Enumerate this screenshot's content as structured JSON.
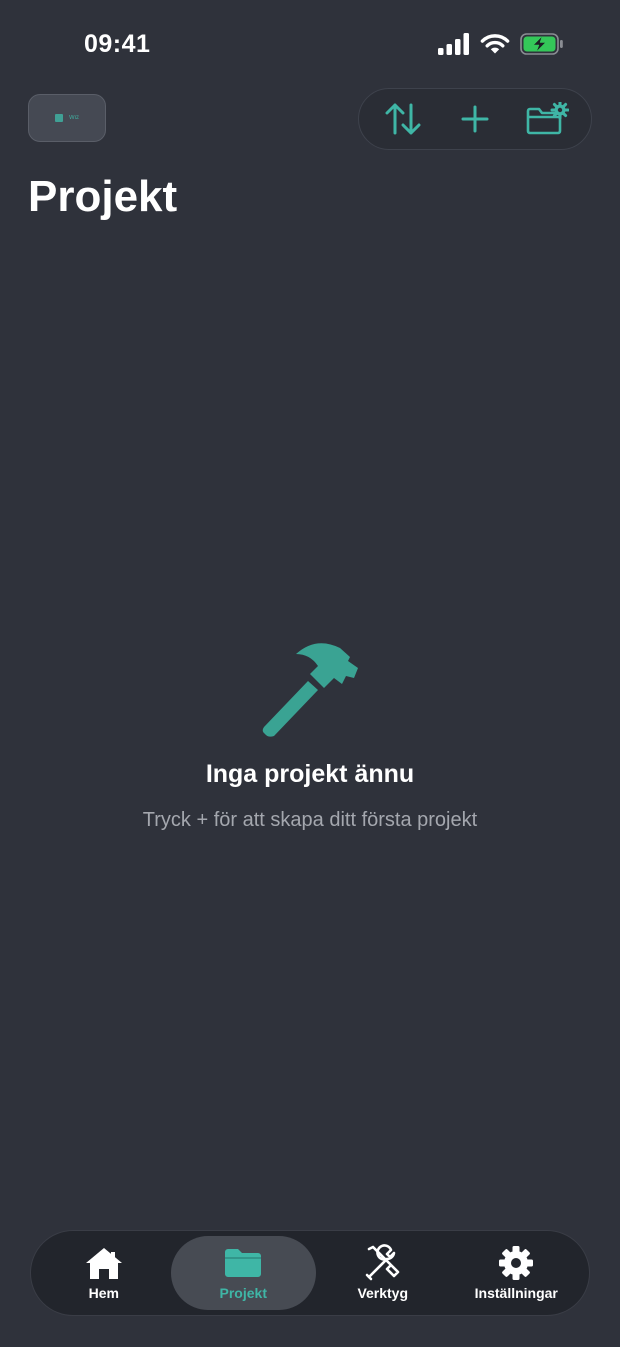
{
  "status": {
    "time": "09:41"
  },
  "header": {
    "title": "Projekt",
    "logo_text": "Wiz",
    "toolbar": [
      {
        "name": "sort",
        "icon": "sort-arrows-icon"
      },
      {
        "name": "add",
        "icon": "plus-icon"
      },
      {
        "name": "folder-settings",
        "icon": "folder-gear-icon"
      }
    ]
  },
  "empty_state": {
    "icon": "hammer-icon",
    "title": "Inga projekt ännu",
    "subtitle": "Tryck + för att skapa ditt första projekt"
  },
  "tabs": [
    {
      "label": "Hem",
      "icon": "home-icon",
      "active": false
    },
    {
      "label": "Projekt",
      "icon": "folder-icon",
      "active": true
    },
    {
      "label": "Verktyg",
      "icon": "tools-icon",
      "active": false
    },
    {
      "label": "Inställningar",
      "icon": "gear-icon",
      "active": false
    }
  ],
  "colors": {
    "accent": "#3fb6a6",
    "background": "#2f323b",
    "tab_bar": "#22252c"
  }
}
